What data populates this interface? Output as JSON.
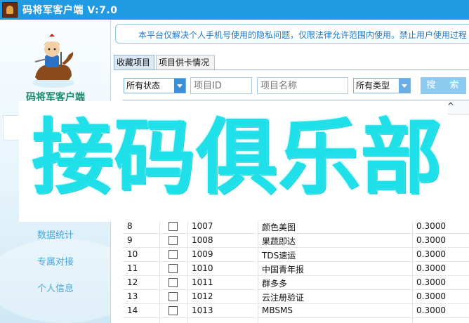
{
  "window": {
    "title": "码将军客户端  V:7.0",
    "icon": "app-logo-icon"
  },
  "sidebar": {
    "brand": "码将军客户端",
    "items": [
      {
        "label": "数据统计"
      },
      {
        "label": "专属对接"
      },
      {
        "label": "个人信息"
      }
    ]
  },
  "notice": {
    "text": "本平台仅解决个人手机号使用的隐私问题，仅限法律允许范围内使用。禁止用户使用过程"
  },
  "tabs": [
    {
      "label": "收藏项目",
      "active": true
    },
    {
      "label": "项目供卡情况",
      "active": false
    }
  ],
  "search": {
    "status_select": "所有状态",
    "project_id_placeholder": "项目ID",
    "project_name_placeholder": "项目名称",
    "type_select": "所有类型",
    "search_button": "搜  索"
  },
  "table": {
    "sort_indicator": "^",
    "rows": [
      {
        "index": "8",
        "id": "1007",
        "name": "颜色美图",
        "price": "0.3000"
      },
      {
        "index": "9",
        "id": "1008",
        "name": "果蔬即达",
        "price": "0.3000"
      },
      {
        "index": "10",
        "id": "1009",
        "name": "TDS速运",
        "price": "0.3000"
      },
      {
        "index": "11",
        "id": "1010",
        "name": "中国青年报",
        "price": "0.3000"
      },
      {
        "index": "12",
        "id": "1011",
        "name": "群多多",
        "price": "0.3000"
      },
      {
        "index": "13",
        "id": "1012",
        "name": "云注册验证",
        "price": "0.3000"
      },
      {
        "index": "14",
        "id": "1013",
        "name": "MBSMS",
        "price": "0.3000"
      }
    ]
  },
  "watermark": {
    "text": "接码俱乐部"
  },
  "colors": {
    "titlebar": "#1f9ae3",
    "accent": "#3a8fd6",
    "watermark": "#1fe0e8",
    "nav_text": "#48a8dc"
  }
}
